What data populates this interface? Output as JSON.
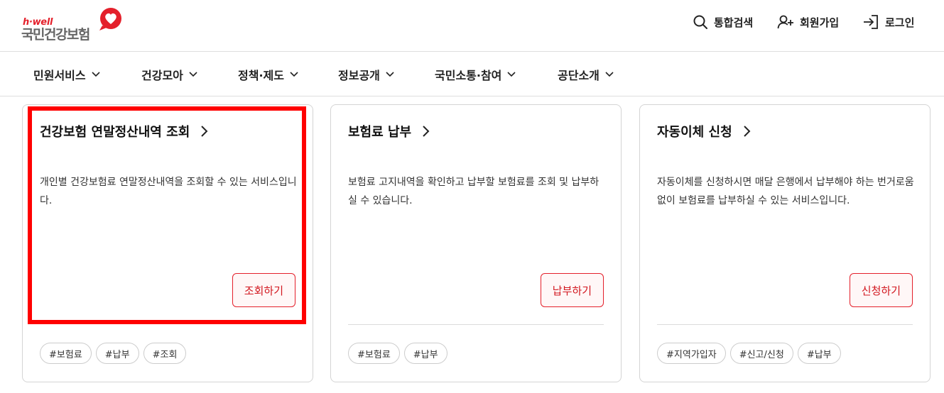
{
  "logo": {
    "small": "h·well",
    "big": "국민건강보험"
  },
  "header": {
    "utilities": [
      {
        "label": "통합검색",
        "icon": "search-icon"
      },
      {
        "label": "회원가입",
        "icon": "user-plus-icon"
      },
      {
        "label": "로그인",
        "icon": "login-icon"
      }
    ]
  },
  "nav": {
    "items": [
      {
        "label": "민원서비스"
      },
      {
        "label": "건강모아"
      },
      {
        "label": "정책·제도"
      },
      {
        "label": "정보공개"
      },
      {
        "label": "국민소통·참여"
      },
      {
        "label": "공단소개"
      }
    ]
  },
  "cards": [
    {
      "title": "건강보험 연말정산내역 조회",
      "desc": "개인별 건강보험료 연말정산내역을 조회할 수 있는 서비스입니다.",
      "button": "조회하기",
      "tags": [
        "#보험료",
        "#납부",
        "#조회"
      ]
    },
    {
      "title": "보험료 납부",
      "desc": "보험료 고지내역을 확인하고 납부할 보험료를 조회 및 납부하실 수 있습니다.",
      "button": "납부하기",
      "tags": [
        "#보험료",
        "#납부"
      ]
    },
    {
      "title": "자동이체 신청",
      "desc": "자동이체를 신청하시면 매달 은행에서 납부해야 하는 번거로움 없이 보험료를 납부하실 수 있는 서비스입니다.",
      "button": "신청하기",
      "tags": [
        "#지역가입자",
        "#신고/신청",
        "#납부"
      ]
    }
  ],
  "colors": {
    "accent": "#e4202b",
    "button_bg": "#fff7f7",
    "highlight": "#ff0000"
  }
}
